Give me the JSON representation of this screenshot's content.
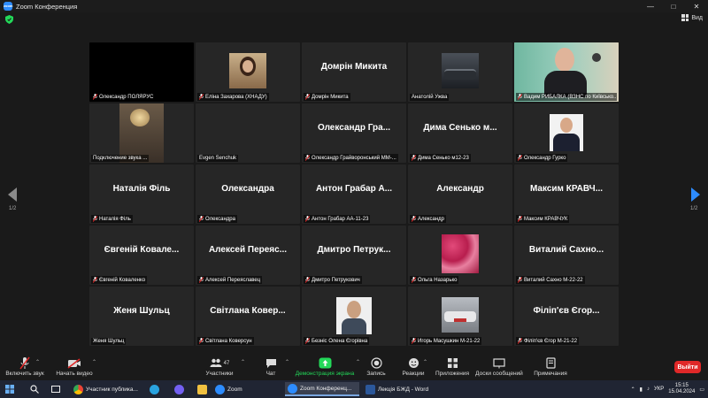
{
  "window": {
    "title": "Zoom Конференция",
    "view_label": "Вид"
  },
  "pagination": {
    "left": "1/2",
    "right": "1/2"
  },
  "tiles": [
    {
      "name": "Олександр ПОЛЯРУС",
      "big": "",
      "kind": "black",
      "muted": true
    },
    {
      "name": "Еліна Захарова (ХНАДУ)",
      "big": "",
      "kind": "photo",
      "photo": "woman-photo",
      "muted": true
    },
    {
      "name": "Домрін Микита",
      "big": "Домрін Микита",
      "kind": "text",
      "muted": true
    },
    {
      "name": "Анатолій Ужва",
      "big": "",
      "kind": "photo",
      "photo": "car-photo",
      "muted": false
    },
    {
      "name": "Вадим РИБАЛКА (ВЗНС по Київсько...",
      "big": "",
      "kind": "video",
      "photo": "man-video",
      "muted": true,
      "speaking": true
    },
    {
      "name": "Подключение звука ...",
      "big": "",
      "kind": "photo",
      "photo": "lamp-photo",
      "muted": false
    },
    {
      "name": "Evgen Senchuk",
      "big": "",
      "kind": "empty",
      "muted": false
    },
    {
      "name": "Олександр Грайворонський ММ-...",
      "big": "Олександр Гра...",
      "kind": "text",
      "muted": true
    },
    {
      "name": "Дима Сенько м12-23",
      "big": "Дима Сенько м...",
      "kind": "text",
      "muted": true
    },
    {
      "name": "Олександр Гурко",
      "big": "",
      "kind": "photo",
      "photo": "suit-photo",
      "muted": true
    },
    {
      "name": "Наталія Філь",
      "big": "Наталія Філь",
      "kind": "text",
      "muted": true
    },
    {
      "name": "Олександра",
      "big": "Олександра",
      "kind": "text",
      "muted": true
    },
    {
      "name": "Антон Грабар АА-11-23",
      "big": "Антон Грабар А...",
      "kind": "text",
      "muted": true
    },
    {
      "name": "Александр",
      "big": "Александр",
      "kind": "text",
      "muted": true
    },
    {
      "name": "Максим КРАВЧУК",
      "big": "Максим КРАВЧ...",
      "kind": "text",
      "muted": true
    },
    {
      "name": "Євгеній Коваленко",
      "big": "Євгеній Ковале...",
      "kind": "text",
      "muted": true
    },
    {
      "name": "Алексей Переяславец",
      "big": "Алексей Переяс...",
      "kind": "text",
      "muted": true
    },
    {
      "name": "Дмитро Петрукович",
      "big": "Дмитро Петрук...",
      "kind": "text",
      "muted": true
    },
    {
      "name": "Ольга Назарько",
      "big": "",
      "kind": "photo",
      "photo": "roses-photo",
      "muted": true
    },
    {
      "name": "Виталий Сахно М-22-22",
      "big": "Виталий Сахно...",
      "kind": "text",
      "muted": true
    },
    {
      "name": "Женя Шульц",
      "big": "Женя Шульц",
      "kind": "text",
      "muted": false
    },
    {
      "name": "Світлана Коверсун",
      "big": "Світлана Ковер...",
      "kind": "text",
      "muted": true
    },
    {
      "name": "Безніс Олена Єгорівна",
      "big": "",
      "kind": "photo",
      "photo": "portrait-photo",
      "muted": true
    },
    {
      "name": "Игорь Масушкин М-21-22",
      "big": "",
      "kind": "photo",
      "photo": "car2-photo",
      "muted": true
    },
    {
      "name": "Філіп'єв Єгор М-21-22",
      "big": "Філіп'єв Єгор...",
      "kind": "text",
      "muted": true
    }
  ],
  "toolbar": {
    "unmute": "Включить звук",
    "start_video": "Начать видео",
    "participants": "Участники",
    "participants_count": "47",
    "chat": "Чат",
    "share": "Демонстрация экрана",
    "record": "Запись",
    "reactions": "Реакции",
    "apps": "Приложения",
    "whiteboards": "Доски сообщений",
    "notes": "Примечания",
    "leave": "Выйти"
  },
  "colors": {
    "share_green": "#23d959",
    "muted_red": "#e02828",
    "speaking_border": "#e8e06a",
    "leave_red": "#e02828"
  },
  "taskbar": {
    "items": [
      {
        "label": "Участник публика...",
        "icon": "chrome-icon"
      },
      {
        "label": "Zoom",
        "icon": "zoom-icon"
      },
      {
        "label": "Zoom Конференц...",
        "icon": "zoom-icon",
        "active": true
      },
      {
        "label": "Лекція БЖД - Word",
        "icon": "word-icon"
      }
    ],
    "lang": "УКР",
    "time": "15:15",
    "date": "15.04.2024"
  }
}
